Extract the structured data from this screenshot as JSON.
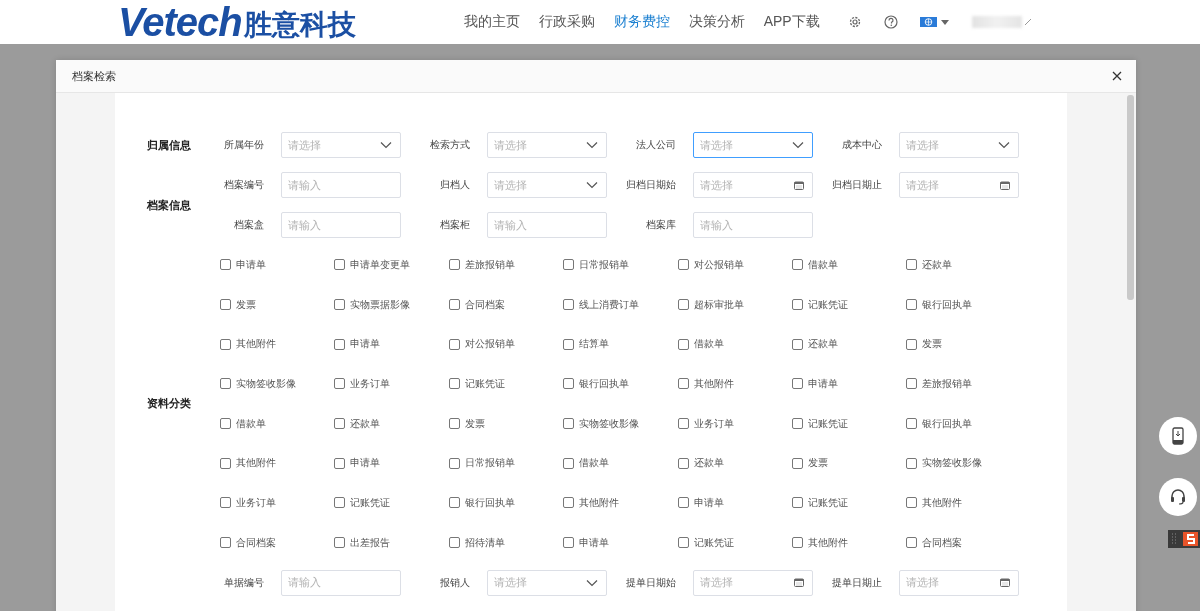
{
  "header": {
    "logo": {
      "latin": "Vetech",
      "chinese": "胜意科技"
    },
    "nav": [
      {
        "label": "我的主页",
        "selected": false
      },
      {
        "label": "行政采购",
        "selected": false
      },
      {
        "label": "财务费控",
        "selected": true
      },
      {
        "label": "决策分析",
        "selected": false
      },
      {
        "label": "APP下载",
        "selected": false
      }
    ]
  },
  "dialog": {
    "title": "档案检索",
    "sections": [
      {
        "title": "归属信息",
        "rows": [
          {
            "kind": "fields",
            "fields": [
              {
                "label": "所属年份",
                "kind": "select",
                "placeholder": "请选择",
                "focused": false
              },
              {
                "label": "检索方式",
                "kind": "select",
                "placeholder": "请选择",
                "focused": false
              },
              {
                "label": "法人公司",
                "kind": "select",
                "placeholder": "请选择",
                "focused": true
              },
              {
                "label": "成本中心",
                "kind": "select",
                "placeholder": "请选择",
                "focused": false
              }
            ]
          }
        ]
      },
      {
        "title": "档案信息",
        "rows": [
          {
            "kind": "fields",
            "fields": [
              {
                "label": "档案编号",
                "kind": "input",
                "placeholder": "请输入",
                "focused": false
              },
              {
                "label": "归档人",
                "kind": "select",
                "placeholder": "请选择",
                "focused": false
              },
              {
                "label": "归档日期始",
                "kind": "date",
                "placeholder": "请选择",
                "focused": false
              },
              {
                "label": "归档日期止",
                "kind": "date",
                "placeholder": "请选择",
                "focused": false
              }
            ]
          },
          {
            "kind": "fields",
            "fields": [
              {
                "label": "档案盒",
                "kind": "input",
                "placeholder": "请输入",
                "focused": false
              },
              {
                "label": "档案柜",
                "kind": "input",
                "placeholder": "请输入",
                "focused": false
              },
              {
                "label": "档案库",
                "kind": "input",
                "placeholder": "请输入",
                "focused": false
              }
            ]
          }
        ]
      },
      {
        "title": "资料分类",
        "rows": [
          {
            "kind": "checkboxes",
            "options": [
              {
                "label": "申请单",
                "checked": false
              },
              {
                "label": "申请单变更单",
                "checked": false
              },
              {
                "label": "差旅报销单",
                "checked": false
              },
              {
                "label": "日常报销单",
                "checked": false
              },
              {
                "label": "对公报销单",
                "checked": false
              },
              {
                "label": "借款单",
                "checked": false
              },
              {
                "label": "还款单",
                "checked": false
              }
            ]
          },
          {
            "kind": "checkboxes",
            "options": [
              {
                "label": "发票",
                "checked": false
              },
              {
                "label": "实物票据影像",
                "checked": false
              },
              {
                "label": "合同档案",
                "checked": false
              },
              {
                "label": "线上消费订单",
                "checked": false
              },
              {
                "label": "超标审批单",
                "checked": false
              },
              {
                "label": "记账凭证",
                "checked": false
              },
              {
                "label": "银行回执单",
                "checked": false
              }
            ]
          },
          {
            "kind": "checkboxes",
            "options": [
              {
                "label": "其他附件",
                "checked": false
              },
              {
                "label": "申请单",
                "checked": false
              },
              {
                "label": "对公报销单",
                "checked": false
              },
              {
                "label": "结算单",
                "checked": false
              },
              {
                "label": "借款单",
                "checked": false
              },
              {
                "label": "还款单",
                "checked": false
              },
              {
                "label": "发票",
                "checked": false
              }
            ]
          },
          {
            "kind": "checkboxes",
            "options": [
              {
                "label": "实物签收影像",
                "checked": false
              },
              {
                "label": "业务订单",
                "checked": false
              },
              {
                "label": "记账凭证",
                "checked": false
              },
              {
                "label": "银行回执单",
                "checked": false
              },
              {
                "label": "其他附件",
                "checked": false
              },
              {
                "label": "申请单",
                "checked": false
              },
              {
                "label": "差旅报销单",
                "checked": false
              }
            ]
          },
          {
            "kind": "checkboxes",
            "options": [
              {
                "label": "借款单",
                "checked": false
              },
              {
                "label": "还款单",
                "checked": false
              },
              {
                "label": "发票",
                "checked": false
              },
              {
                "label": "实物签收影像",
                "checked": false
              },
              {
                "label": "业务订单",
                "checked": false
              },
              {
                "label": "记账凭证",
                "checked": false
              },
              {
                "label": "银行回执单",
                "checked": false
              }
            ]
          },
          {
            "kind": "checkboxes",
            "options": [
              {
                "label": "其他附件",
                "checked": false
              },
              {
                "label": "申请单",
                "checked": false
              },
              {
                "label": "日常报销单",
                "checked": false
              },
              {
                "label": "借款单",
                "checked": false
              },
              {
                "label": "还款单",
                "checked": false
              },
              {
                "label": "发票",
                "checked": false
              },
              {
                "label": "实物签收影像",
                "checked": false
              }
            ]
          },
          {
            "kind": "checkboxes",
            "options": [
              {
                "label": "业务订单",
                "checked": false
              },
              {
                "label": "记账凭证",
                "checked": false
              },
              {
                "label": "银行回执单",
                "checked": false
              },
              {
                "label": "其他附件",
                "checked": false
              },
              {
                "label": "申请单",
                "checked": false
              },
              {
                "label": "记账凭证",
                "checked": false
              },
              {
                "label": "其他附件",
                "checked": false
              }
            ]
          },
          {
            "kind": "checkboxes",
            "options": [
              {
                "label": "合同档案",
                "checked": false
              },
              {
                "label": "出差报告",
                "checked": false
              },
              {
                "label": "招待清单",
                "checked": false
              },
              {
                "label": "申请单",
                "checked": false
              },
              {
                "label": "记账凭证",
                "checked": false
              },
              {
                "label": "其他附件",
                "checked": false
              },
              {
                "label": "合同档案",
                "checked": false
              }
            ]
          }
        ]
      },
      {
        "rows": [
          {
            "kind": "fields",
            "fields": [
              {
                "label": "单据编号",
                "kind": "input",
                "placeholder": "请输入",
                "focused": false
              },
              {
                "label": "报销人",
                "kind": "select",
                "placeholder": "请选择",
                "focused": false
              },
              {
                "label": "提单日期始",
                "kind": "date",
                "placeholder": "请选择",
                "focused": false
              },
              {
                "label": "提单日期止",
                "kind": "date",
                "placeholder": "请选择",
                "focused": false
              }
            ]
          }
        ]
      }
    ]
  }
}
